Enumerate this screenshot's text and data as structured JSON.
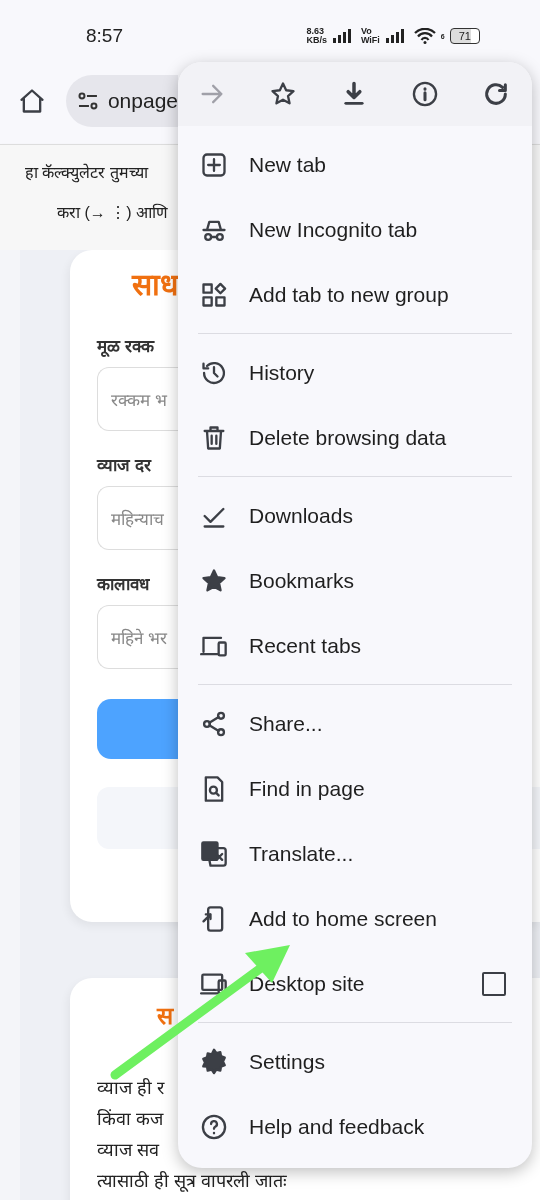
{
  "status_bar": {
    "time": "8:57",
    "speed": [
      "8.63",
      "KB/s"
    ],
    "volte": [
      "Vo",
      "WiFi"
    ],
    "wifi_label": "6",
    "battery": "71"
  },
  "toolbar": {
    "url": "onpage"
  },
  "banner": {
    "lines": [
      "हा कॅल्क्युलेटर तुमच्या",
      "करा (→ ⋮) आणि"
    ]
  },
  "calculator_card": {
    "title": "साध",
    "fields": [
      {
        "label": "मूळ रक्क",
        "placeholder": "रक्कम भ"
      },
      {
        "label": "व्याज दर",
        "placeholder": "महिन्याच"
      },
      {
        "label": "कालावध",
        "placeholder": "महिने भर"
      }
    ]
  },
  "info_card": {
    "heading": "स",
    "lines": [
      "व्याज ही र",
      "किंवा कज",
      "व्याज सव",
      "त्यासाठी ही सूत्र वापरली जातः"
    ]
  },
  "menu": {
    "toolbar": [
      {
        "kind": "forward",
        "disabled": true
      },
      {
        "kind": "bookmark",
        "disabled": false
      },
      {
        "kind": "download",
        "disabled": false
      },
      {
        "kind": "info",
        "disabled": false
      },
      {
        "kind": "reload",
        "disabled": false
      }
    ],
    "groups": [
      [
        {
          "kind": "new-tab",
          "label": "New tab"
        },
        {
          "kind": "incognito",
          "label": "New Incognito tab"
        },
        {
          "kind": "group",
          "label": "Add tab to new group"
        }
      ],
      [
        {
          "kind": "history",
          "label": "History"
        },
        {
          "kind": "delete",
          "label": "Delete browsing data"
        }
      ],
      [
        {
          "kind": "downloads",
          "label": "Downloads"
        },
        {
          "kind": "bookmarks",
          "label": "Bookmarks"
        },
        {
          "kind": "recent",
          "label": "Recent tabs"
        }
      ],
      [
        {
          "kind": "share",
          "label": "Share..."
        },
        {
          "kind": "find",
          "label": "Find in page"
        },
        {
          "kind": "translate",
          "label": "Translate..."
        },
        {
          "kind": "home",
          "label": "Add to home screen"
        },
        {
          "kind": "desktop",
          "label": "Desktop site",
          "checked": false
        }
      ],
      [
        {
          "kind": "settings",
          "label": "Settings"
        },
        {
          "kind": "help",
          "label": "Help and feedback"
        }
      ]
    ]
  }
}
